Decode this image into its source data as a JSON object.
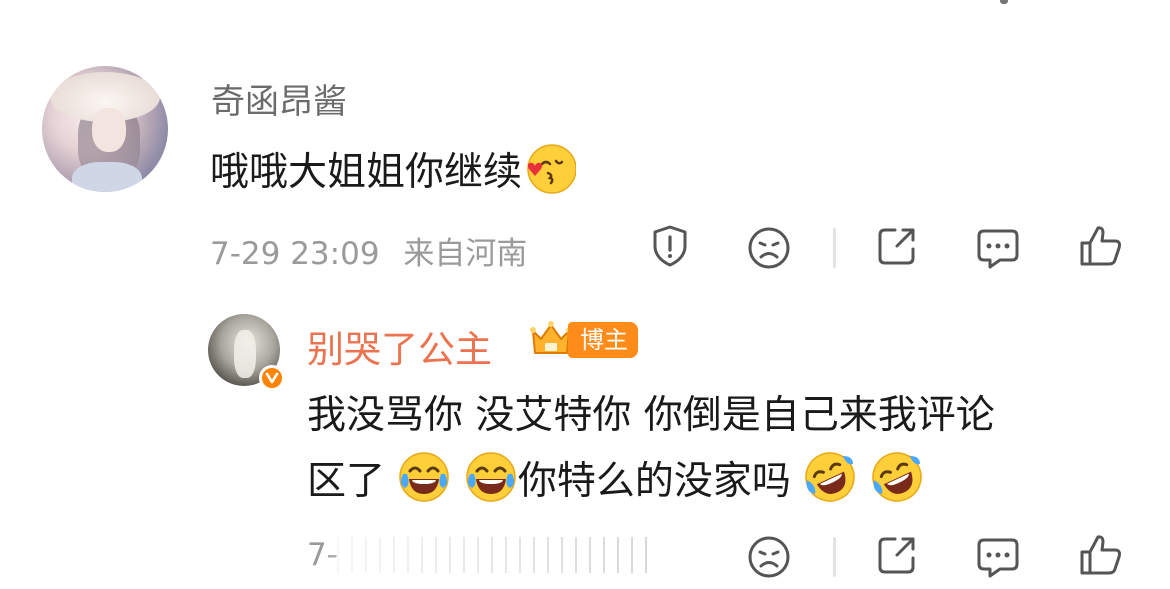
{
  "comment": {
    "username": "奇函昂酱",
    "text": "哦哦大姐姐你继续",
    "emoji": "kiss-emoji",
    "time": "7-29 23:09",
    "location": "来自河南",
    "actions": [
      "report-icon",
      "dislike-icon",
      "share-icon",
      "reply-icon",
      "like-icon"
    ]
  },
  "reply": {
    "username": "别哭了公主",
    "badge": "博主",
    "text_line1": "我没骂你 没艾特你 你倒是自己来我评论",
    "text_line2_a": "区了",
    "text_line2_b": "你特么的没家吗",
    "emojis": [
      "laugh-cry-emoji",
      "laugh-cry-emoji",
      "rolling-laugh-emoji",
      "rolling-laugh-emoji"
    ],
    "time_partial": "7-",
    "actions": [
      "dislike-icon",
      "share-icon",
      "reply-icon",
      "like-icon"
    ]
  },
  "colors": {
    "username_primary": "#eb7350",
    "badge_bg": "#ff8c1a",
    "meta_text": "#9a9a9a",
    "body_text": "#1a1a1a"
  }
}
